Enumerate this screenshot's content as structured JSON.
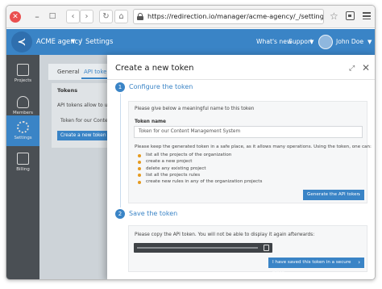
{
  "browser": {
    "url": "https://redirection.io/manager/acme-agency/_/settings/api-tokens?c"
  },
  "header": {
    "logo": "≺",
    "agency": "ACME agency",
    "breadcrumb_sep": "/",
    "section": "Settings",
    "whats_new": "What's new",
    "support": "Support",
    "user": "John Doe"
  },
  "sidebar": {
    "items": [
      {
        "label": "Projects"
      },
      {
        "label": "Members"
      },
      {
        "label": "Settings"
      },
      {
        "label": "Billing"
      }
    ]
  },
  "background_page": {
    "tabs": [
      "General",
      "API tokens"
    ],
    "tokens_title": "Tokens",
    "tokens_desc": "API tokens allow to use",
    "token_item": "Token for our Content",
    "create_button": "Create a new token"
  },
  "drawer": {
    "title": "Create a new token",
    "step1": {
      "number": "1",
      "title": "Configure the token",
      "intro": "Please give below a meaningful name to this token",
      "name_label": "Token name",
      "name_value": "Token for our Content Management System",
      "permissions_intro": "Please keep the generated token in a safe place, as it allows many operations. Using the token, one can:",
      "permissions": [
        "list all the projects of the organization",
        "create a new project",
        "delete any existing project",
        "list all the projects rules",
        "create new rules in any of the organization projects"
      ],
      "generate_button": "Generate the API token"
    },
    "step2": {
      "number": "2",
      "title": "Save the token",
      "intro": "Please copy the API token. You will not be able to display it again afterwards:",
      "saved_button": "I have saved this token in a secure place"
    }
  },
  "colors": {
    "accent": "#3a84c6",
    "bullet": "#e59a1f",
    "sidebar": "#4a4f54"
  }
}
